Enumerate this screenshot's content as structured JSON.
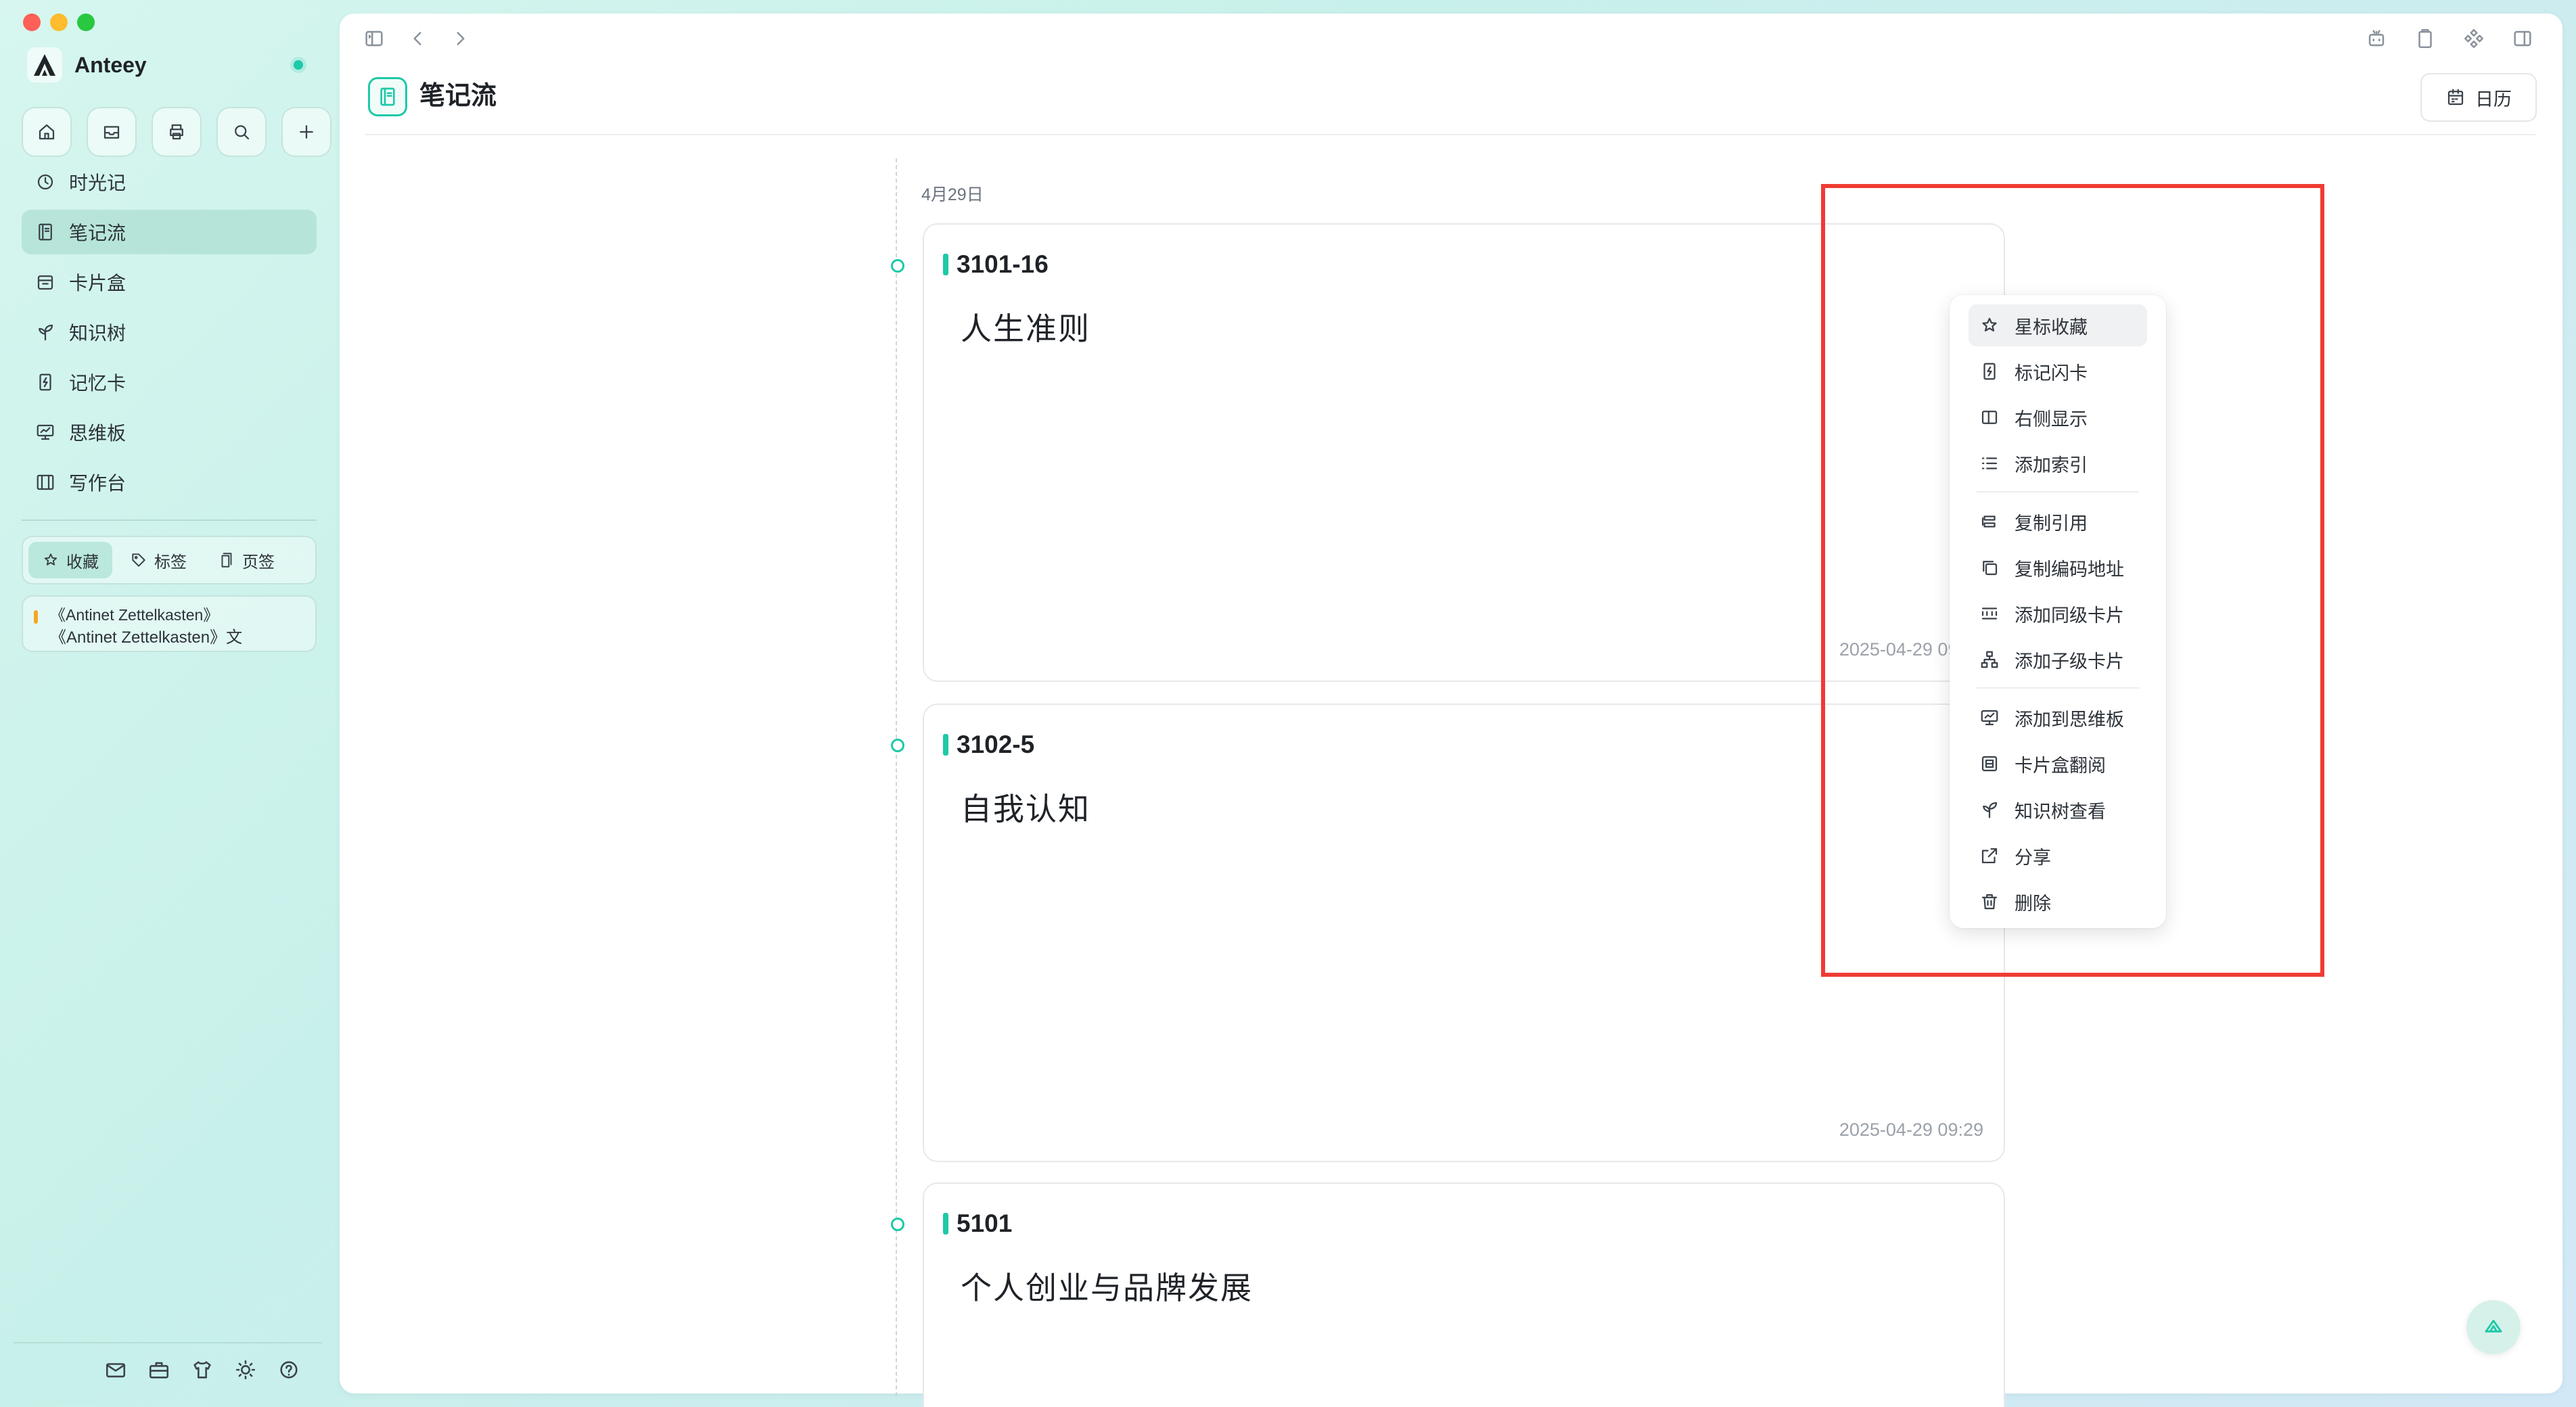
{
  "app": {
    "name": "Anteey"
  },
  "sidebar": {
    "quick_actions": [
      "home-icon",
      "inbox-icon",
      "print-icon",
      "search-icon",
      "plus-icon"
    ],
    "nav": [
      {
        "label": "时光记",
        "icon": "clock-icon",
        "active": false
      },
      {
        "label": "笔记流",
        "icon": "notebook-icon",
        "active": true
      },
      {
        "label": "卡片盒",
        "icon": "card-box-icon",
        "active": false
      },
      {
        "label": "知识树",
        "icon": "sprout-icon",
        "active": false
      },
      {
        "label": "记忆卡",
        "icon": "flashcard-icon",
        "active": false
      },
      {
        "label": "思维板",
        "icon": "board-icon",
        "active": false
      },
      {
        "label": "写作台",
        "icon": "desk-icon",
        "active": false
      }
    ],
    "tabs": [
      {
        "label": "收藏",
        "icon": "star-icon",
        "active": true
      },
      {
        "label": "标签",
        "icon": "tag-icon",
        "active": false
      },
      {
        "label": "页签",
        "icon": "page-icon",
        "active": false
      }
    ],
    "favorites": [
      {
        "line1": "《Antinet Zettelkasten》",
        "line2": "《Antinet Zettelkasten》文"
      }
    ],
    "bottom_icons": [
      "mail-icon",
      "toolbox-icon",
      "shirt-icon",
      "sun-icon",
      "help-icon"
    ]
  },
  "header": {
    "title": "笔记流",
    "calendar_label": "日历"
  },
  "timeline": {
    "date": "4月29日",
    "cards": [
      {
        "code": "3101-16",
        "title": "人生准则",
        "time": "2025-04-29 09:29"
      },
      {
        "code": "3102-5",
        "title": "自我认知",
        "time": "2025-04-29 09:29"
      },
      {
        "code": "5101",
        "title": "个人创业与品牌发展",
        "time": ""
      }
    ]
  },
  "context_menu": {
    "groups": [
      [
        {
          "label": "星标收藏",
          "icon": "star-icon"
        },
        {
          "label": "标记闪卡",
          "icon": "flashcard-icon"
        },
        {
          "label": "右侧显示",
          "icon": "split-panel-icon"
        },
        {
          "label": "添加索引",
          "icon": "list-index-icon"
        }
      ],
      [
        {
          "label": "复制引用",
          "icon": "copy-ref-icon"
        },
        {
          "label": "复制编码地址",
          "icon": "copy-icon"
        },
        {
          "label": "添加同级卡片",
          "icon": "sibling-card-icon"
        },
        {
          "label": "添加子级卡片",
          "icon": "hierarchy-icon"
        }
      ],
      [
        {
          "label": "添加到思维板",
          "icon": "board-icon"
        },
        {
          "label": "卡片盒翻阅",
          "icon": "card-browse-icon"
        },
        {
          "label": "知识树查看",
          "icon": "sprout-icon"
        },
        {
          "label": "分享",
          "icon": "share-icon"
        },
        {
          "label": "删除",
          "icon": "trash-icon"
        }
      ]
    ]
  },
  "colors": {
    "accent": "#1ec9a7",
    "highlight_box": "#ef3b33",
    "favorite_marker": "#f5a623"
  }
}
